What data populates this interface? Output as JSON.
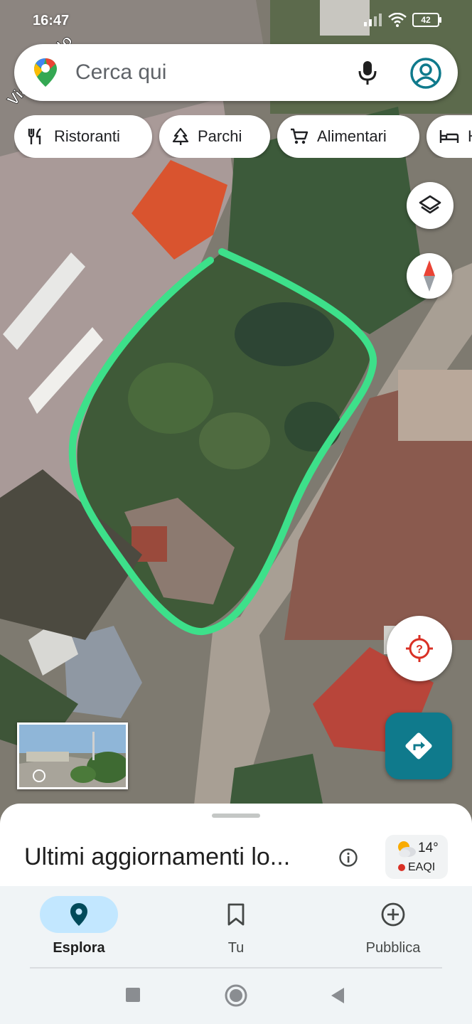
{
  "status_bar": {
    "time": "16:47",
    "battery": "42",
    "icons": [
      "signal-icon",
      "wifi-icon",
      "battery-icon"
    ]
  },
  "map": {
    "street_label": "Via ... nardo",
    "highlight_color": "#3de08a"
  },
  "search": {
    "placeholder": "Cerca qui"
  },
  "chips": [
    {
      "label": "Ristoranti",
      "icon": "fork-knife-icon"
    },
    {
      "label": "Parchi",
      "icon": "tree-icon"
    },
    {
      "label": "Alimentari",
      "icon": "cart-icon"
    },
    {
      "label": "H",
      "icon": "bed-icon"
    }
  ],
  "fabs": {
    "layers": "layers-icon",
    "compass": "compass-icon",
    "locate": "locate-icon",
    "directions": "directions-icon"
  },
  "sheet": {
    "title": "Ultimi aggiornamenti lo...",
    "weather": {
      "temp": "14°",
      "aqi": "EAQI"
    }
  },
  "nav": [
    {
      "label": "Esplora",
      "icon": "explore-pin-icon",
      "active": true
    },
    {
      "label": "Tu",
      "icon": "bookmark-icon",
      "active": false
    },
    {
      "label": "Pubblica",
      "icon": "add-circle-icon",
      "active": false
    }
  ],
  "colors": {
    "accent": "#0f7a8c",
    "active_pill": "#c2e7ff",
    "aqi_dot": "#d93025"
  }
}
